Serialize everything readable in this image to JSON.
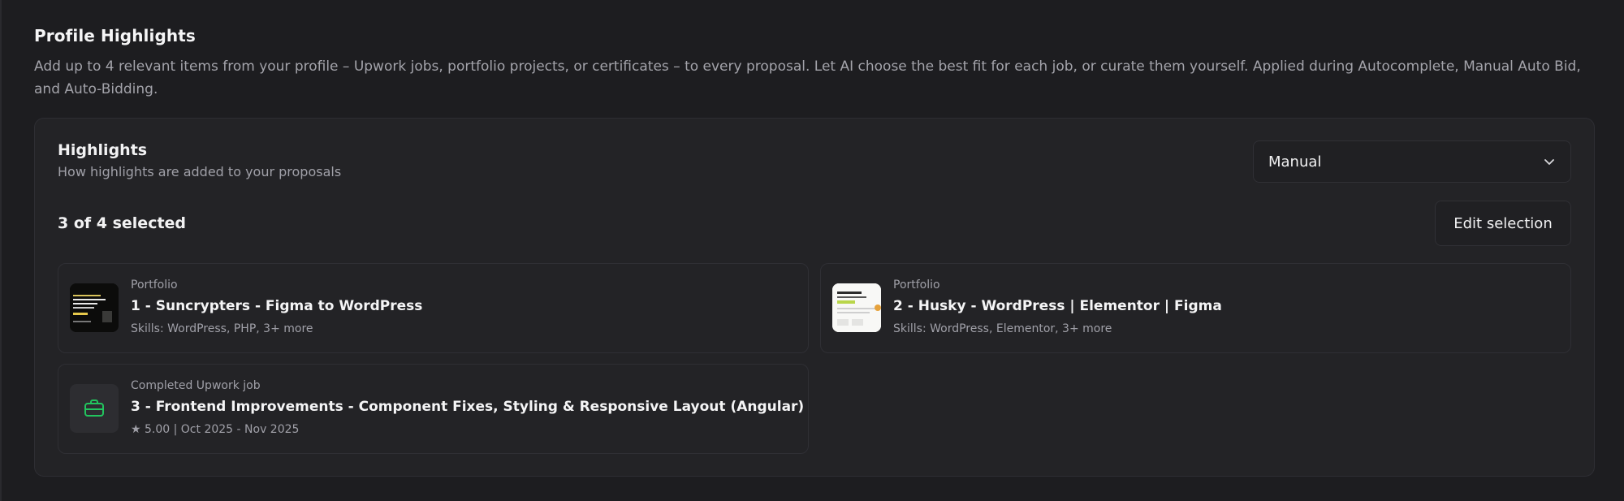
{
  "section": {
    "title": "Profile Highlights",
    "description": "Add up to 4 relevant items from your profile – Upwork jobs, portfolio projects, or certificates – to every proposal. Let AI choose the best fit for each job, or curate them yourself. Applied during Autocomplete, Manual Auto Bid, and Auto-Bidding."
  },
  "highlights": {
    "title": "Highlights",
    "subtitle": "How highlights are added to your proposals",
    "mode": {
      "selected": "Manual",
      "icon": "chevron-down-icon"
    },
    "count_label": "3 of 4 selected",
    "edit_button": "Edit selection",
    "items": [
      {
        "kind": "Portfolio",
        "title": "1 - Suncrypters - Figma to WordPress",
        "meta": "Skills: WordPress, PHP, 3+ more"
      },
      {
        "kind": "Portfolio",
        "title": "2 - Husky - WordPress | Elementor | Figma",
        "meta": "Skills: WordPress, Elementor, 3+ more"
      },
      {
        "kind": "Completed Upwork job",
        "title": "3 - Frontend Improvements - Component Fixes, Styling & Responsive Layout (Angular)",
        "meta": "★ 5.00 | Oct 2025 - Nov 2025",
        "icon": "briefcase-icon"
      }
    ]
  },
  "colors": {
    "background": "#1d1d20",
    "card": "#232326",
    "border": "#2f2f34",
    "text_primary": "#f2f2f3",
    "text_secondary": "#a0a0a8",
    "accent_green": "#22c55e"
  }
}
